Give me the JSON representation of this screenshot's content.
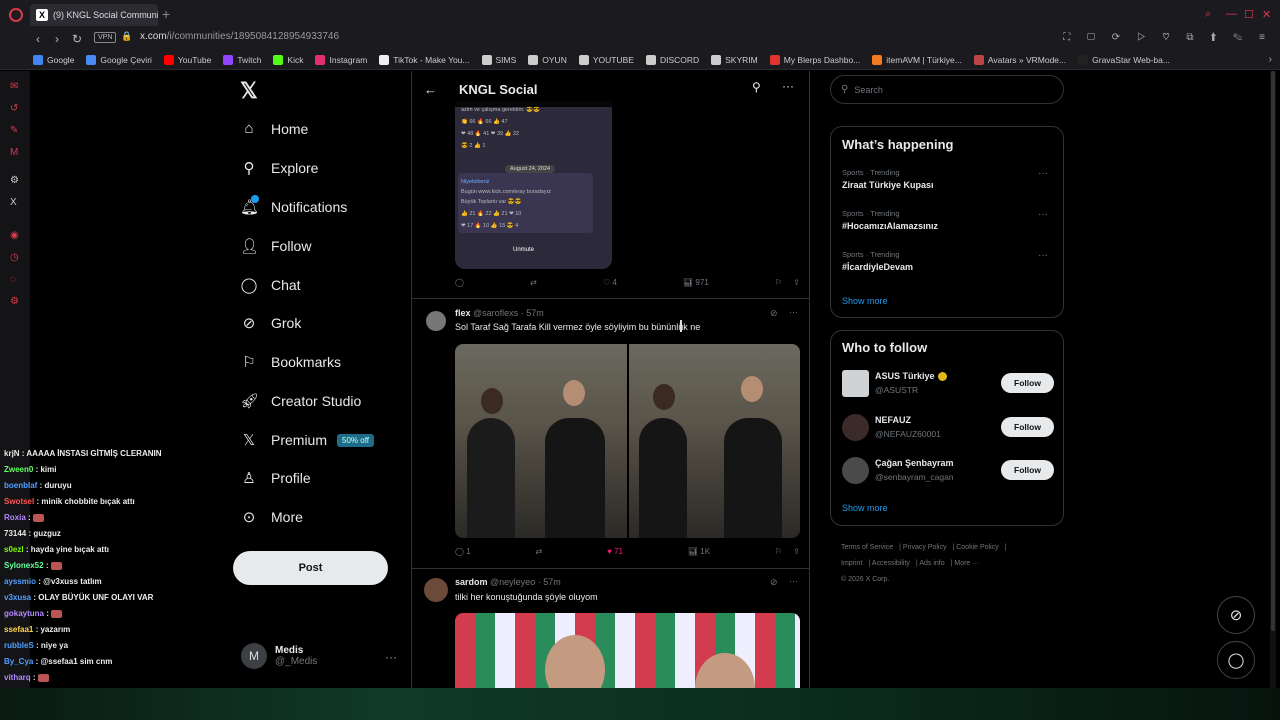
{
  "browser": {
    "tab_title": "(9) KNGL Social Communi",
    "url_host": "x.com",
    "url_path": "/i/communities/1895084128954933746",
    "vpn_label": "VPN",
    "bookmarks": [
      {
        "label": "Google",
        "icon": "google-icon",
        "color": "#4285f4"
      },
      {
        "label": "Google Çeviri",
        "icon": "translate-icon",
        "color": "#4a8af4"
      },
      {
        "label": "YouTube",
        "icon": "youtube-icon",
        "color": "#ff0000"
      },
      {
        "label": "Twitch",
        "icon": "twitch-icon",
        "color": "#9146ff"
      },
      {
        "label": "Kick",
        "icon": "kick-icon",
        "color": "#53fc18"
      },
      {
        "label": "Instagram",
        "icon": "instagram-icon",
        "color": "#e1306c"
      },
      {
        "label": "TikTok - Make You...",
        "icon": "tiktok-icon",
        "color": "#eeeeee"
      },
      {
        "label": "SIMS",
        "icon": "folder-icon",
        "color": "#cccccc"
      },
      {
        "label": "OYUN",
        "icon": "folder-icon",
        "color": "#cccccc"
      },
      {
        "label": "YOUTUBE",
        "icon": "folder-icon",
        "color": "#cccccc"
      },
      {
        "label": "DISCORD",
        "icon": "folder-icon",
        "color": "#cccccc"
      },
      {
        "label": "SKYRIM",
        "icon": "folder-icon",
        "color": "#cccccc"
      },
      {
        "label": "My Blerps Dashbo...",
        "icon": "blerp-icon",
        "color": "#e0342f"
      },
      {
        "label": "itemAVM | Türkiye...",
        "icon": "itemavm-icon",
        "color": "#f07a22"
      },
      {
        "label": "Avatars » VRMode...",
        "icon": "vrmodels-icon",
        "color": "#bb4444"
      },
      {
        "label": "GravaStar Web-ba...",
        "icon": "gravastar-icon",
        "color": "#222222"
      }
    ]
  },
  "nav": {
    "home": "Home",
    "explore": "Explore",
    "notifications": "Notifications",
    "follow": "Follow",
    "chat": "Chat",
    "grok": "Grok",
    "bookmarks": "Bookmarks",
    "creator_studio": "Creator Studio",
    "premium": "Premium",
    "premium_badge": "50% off",
    "profile": "Profile",
    "more": "More",
    "post": "Post",
    "account_name": "Medis",
    "account_handle": "@_Medis",
    "account_initial": "M"
  },
  "stream_chat": [
    {
      "user": "krjN",
      "color": "#e7e7e7",
      "msg": ": AAAAA İNSTASI GİTMİŞ CLERANIN"
    },
    {
      "user": "Zween0",
      "color": "#66ff66",
      "msg": ": kimi"
    },
    {
      "user": "boenblaf",
      "color": "#4fa0ff",
      "msg": ": duruyu"
    },
    {
      "user": "Swotsel",
      "color": "#ff5555",
      "msg": ": minik chobbite bıçak attı"
    },
    {
      "user": "Roxia",
      "color": "#b388ff",
      "msg": ":"
    },
    {
      "user": "73144",
      "color": "#e7e7e7",
      "msg": ": guzguz"
    },
    {
      "user": "s0ezl",
      "color": "#7cfc00",
      "msg": ": hayda yine bıçak attı"
    },
    {
      "user": "Sylonex52",
      "color": "#66ff99",
      "msg": ":"
    },
    {
      "user": "ayssmio",
      "color": "#4fa0ff",
      "msg": ": @v3xuss tatlım"
    },
    {
      "user": "v3xusa",
      "color": "#4fa0ff",
      "msg": ": OLAY BÜYÜK UNF OLAYI VAR"
    },
    {
      "user": "gokaytuna",
      "color": "#b388ff",
      "msg": ":"
    },
    {
      "user": "ssefaa1",
      "color": "#ffd54f",
      "msg": ": yazarım"
    },
    {
      "user": "rubbleS",
      "color": "#4fa0ff",
      "msg": ": niye ya"
    },
    {
      "user": "By_Cya",
      "color": "#4fa0ff",
      "msg": ": @ssefaa1 sim cnm"
    },
    {
      "user": "vitharq",
      "color": "#b388ff",
      "msg": ":"
    }
  ],
  "feed": {
    "title": "KNGL Social",
    "media1": {
      "row1": "azim ve çalışma gerektirir. 😎😎",
      "row2": "👏 66   🔥 66   👍 47",
      "row3": "❤ 48   🔥 41   ❤ 39   👍 22",
      "row4": "😎 2   👍 1",
      "date": "August 24, 2024",
      "b1": "Niyetsiberiz",
      "b2": "Bugün www.kick.com/eray buradayız",
      "b3": "Büyük Toplantı var 😎😎",
      "b4": "👍 21   🔥 22   👍 21   ❤ 10",
      "b5": "❤ 17   🔥 10   👍 15   😎 4",
      "unmute": "Unmute"
    },
    "post1_actions": {
      "likes": "4",
      "views": "971"
    },
    "post2": {
      "name": "flex",
      "handle": "@saroflexs",
      "time": "· 57m",
      "text": "Sol Taraf Sağ Tarafa Kill vermez öyle söyliyim bu bününlük ne",
      "replies": "1",
      "likes": "71",
      "views": "1K"
    },
    "post3": {
      "name": "sardom",
      "handle": "@neyleyeo",
      "time": "· 57m",
      "text": "tilki her konuştuğunda şöyle oluyom"
    }
  },
  "right": {
    "search_placeholder": "Search",
    "whats_happening": "What’s happening",
    "trends": [
      {
        "meta": "Sports · Trending",
        "title": "Ziraat Türkiye Kupası"
      },
      {
        "meta": "Sports · Trending",
        "title": "#HocamızıAlamazsınız"
      },
      {
        "meta": "Sports · Trending",
        "title": "#İcardiyleDevam"
      }
    ],
    "show_more": "Show more",
    "who_to_follow": "Who to follow",
    "follow_suggestions": [
      {
        "name": "ASUS Türkiye",
        "handle": "@ASUSTR",
        "button": "Follow"
      },
      {
        "name": "NEFAUZ",
        "handle": "@NEFAUZ60001",
        "button": "Follow"
      },
      {
        "name": "Çağan Şenbayram",
        "handle": "@senbayram_cagan",
        "button": "Follow"
      }
    ],
    "show_more_2": "Show more",
    "footer": {
      "terms": "Terms of Service",
      "privacy": "Privacy Policy",
      "cookie": "Cookie Policy",
      "imprint": "Imprint",
      "accessibility": "Accessibility",
      "ads": "Ads info",
      "more": "More ···",
      "copyright": "© 2026 X Corp."
    }
  }
}
